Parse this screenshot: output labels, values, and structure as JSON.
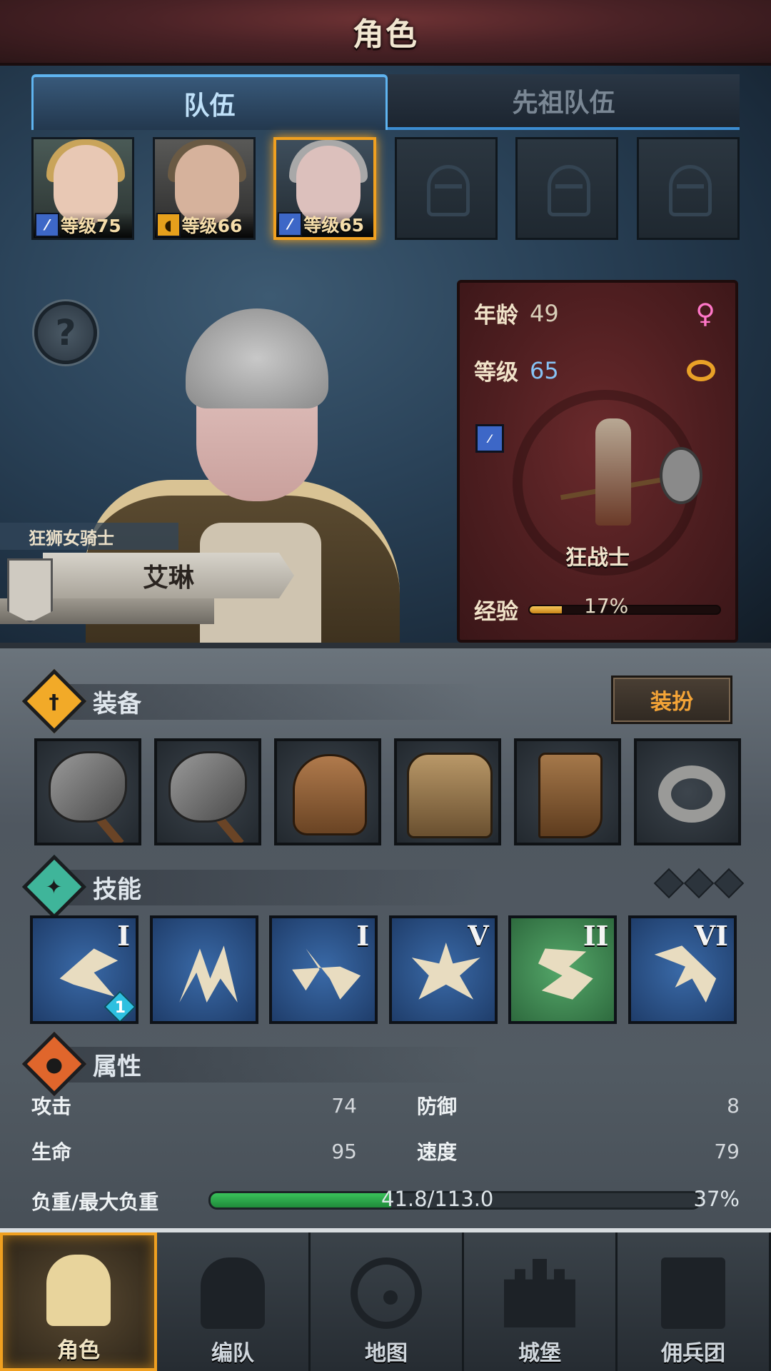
{
  "header": {
    "title": "角色"
  },
  "tabs": [
    {
      "label": "队伍",
      "active": true
    },
    {
      "label": "先祖队伍",
      "active": false
    }
  ],
  "party_slots": [
    {
      "level_text": "等级75",
      "class_icon": "sword-icon",
      "starred": true
    },
    {
      "level_text": "等级66",
      "class_icon": "shield-icon",
      "starred": false
    },
    {
      "level_text": "等级65",
      "class_icon": "sword-icon",
      "selected": true
    },
    {
      "empty": true,
      "icon": "helmet-placeholder-icon"
    },
    {
      "empty": true,
      "icon": "helmet-placeholder-icon"
    },
    {
      "empty": true,
      "icon": "helmet-placeholder-icon"
    }
  ],
  "help_button": {
    "icon": "question-icon",
    "glyph": "?"
  },
  "character": {
    "title": "狂狮女骑士",
    "name": "艾琳"
  },
  "info_card": {
    "age_label": "年龄",
    "age_value": "49",
    "gender_icon": "female-icon",
    "level_label": "等级",
    "level_value": "65",
    "marriage_icon": "rings-icon",
    "class_icon": "sword-icon",
    "class_name": "狂战士",
    "exp_label": "经验",
    "exp_percent": 17,
    "exp_text": "17%"
  },
  "equipment": {
    "title": "装备",
    "outfit_button": "装扮",
    "items": [
      {
        "name": "battle-axe-icon"
      },
      {
        "name": "battle-axe-icon"
      },
      {
        "name": "leather-helmet-icon"
      },
      {
        "name": "leather-armor-icon"
      },
      {
        "name": "leather-boots-icon"
      },
      {
        "name": "iron-ring-icon"
      }
    ]
  },
  "skills": {
    "title": "技能",
    "list": [
      {
        "name": "charge-skill-icon",
        "rank": "I",
        "gem": "1"
      },
      {
        "name": "claw-skill-icon",
        "rank": ""
      },
      {
        "name": "crystal-strike-skill-icon",
        "rank": "I"
      },
      {
        "name": "burst-skill-icon",
        "rank": "V"
      },
      {
        "name": "whirl-skill-icon",
        "rank": "II",
        "color": "green"
      },
      {
        "name": "leap-skill-icon",
        "rank": "VI"
      }
    ]
  },
  "attributes": {
    "title": "属性",
    "attack_label": "攻击",
    "attack_value": "74",
    "defense_label": "防御",
    "defense_value": "8",
    "hp_label": "生命",
    "hp_value": "95",
    "speed_label": "速度",
    "speed_value": "79",
    "load_label": "负重/最大负重",
    "load_text": "41.8/113.0",
    "load_percent": 37,
    "load_percent_text": "37%"
  },
  "nav": [
    {
      "label": "角色",
      "icon": "knight-icon",
      "active": true
    },
    {
      "label": "编队",
      "icon": "helmet-icon",
      "active": false
    },
    {
      "label": "地图",
      "icon": "compass-icon",
      "active": false
    },
    {
      "label": "城堡",
      "icon": "castle-icon",
      "active": false
    },
    {
      "label": "佣兵团",
      "icon": "banner-icon",
      "active": false
    }
  ],
  "colors": {
    "accent_orange": "#f0a020",
    "tab_blue": "#5fb4f0",
    "card_red": "#4e1e20",
    "load_green": "#3ac15a"
  }
}
